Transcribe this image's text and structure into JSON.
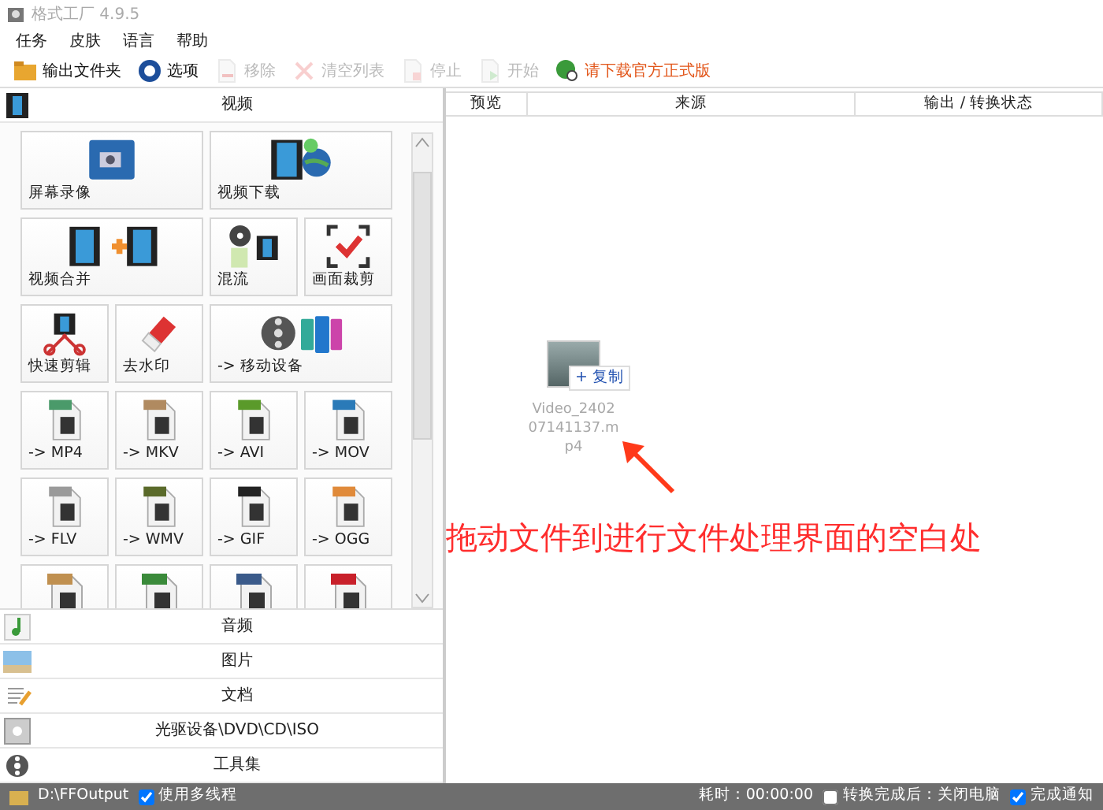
{
  "window": {
    "title": "格式工厂 4.9.5",
    "active": false
  },
  "menu": [
    "任务",
    "皮肤",
    "语言",
    "帮助"
  ],
  "toolbar": [
    {
      "kind": "folder",
      "label": "输出文件夹",
      "disabled": false
    },
    {
      "kind": "options",
      "label": "选项",
      "disabled": false
    },
    {
      "kind": "remove",
      "label": "移除",
      "disabled": true
    },
    {
      "kind": "clear",
      "label": "清空列表",
      "disabled": true
    },
    {
      "kind": "stop",
      "label": "停止",
      "disabled": true
    },
    {
      "kind": "start",
      "label": "开始",
      "disabled": true
    },
    {
      "kind": "link",
      "label": "请下载官方正式版",
      "disabled": false
    }
  ],
  "sidebar": {
    "open_category": {
      "kind": "video",
      "label": "视频"
    },
    "categories": [
      {
        "kind": "audio",
        "label": "音频"
      },
      {
        "kind": "image",
        "label": "图片"
      },
      {
        "kind": "document",
        "label": "文档"
      },
      {
        "kind": "disc",
        "label": "光驱设备\\DVD\\CD\\ISO"
      },
      {
        "kind": "tools",
        "label": "工具集"
      }
    ],
    "tiles": [
      {
        "kind": "screen",
        "label": "屏幕录像",
        "wide": true
      },
      {
        "kind": "download",
        "label": "视频下载",
        "wide": true
      },
      {
        "kind": "merge",
        "label": "视频合并",
        "wide": true
      },
      {
        "kind": "mux",
        "label": "混流",
        "wide": false
      },
      {
        "kind": "crop",
        "label": "画面裁剪",
        "wide": false
      },
      {
        "kind": "cut",
        "label": "快速剪辑",
        "wide": false
      },
      {
        "kind": "watermark",
        "label": "去水印",
        "wide": false
      },
      {
        "kind": "device",
        "label": "-> 移动设备",
        "wide": true
      },
      {
        "kind": "format",
        "label": "-> MP4",
        "wide": false,
        "color": "#4a9a6a"
      },
      {
        "kind": "format",
        "label": "-> MKV",
        "wide": false,
        "color": "#b08a60"
      },
      {
        "kind": "format",
        "label": "-> AVI",
        "wide": false,
        "color": "#5a9a2a"
      },
      {
        "kind": "format",
        "label": "-> MOV",
        "wide": false,
        "color": "#2a7ab8"
      },
      {
        "kind": "format",
        "label": "-> FLV",
        "wide": false,
        "color": "#9a9a9a"
      },
      {
        "kind": "format",
        "label": "-> WMV",
        "wide": false,
        "color": "#5a6a2a"
      },
      {
        "kind": "format",
        "label": "-> GIF",
        "wide": false,
        "color": "#222222"
      },
      {
        "kind": "format",
        "label": "-> OGG",
        "wide": false,
        "color": "#e08a3a"
      },
      {
        "kind": "format",
        "wide": false,
        "color": "#c09050"
      },
      {
        "kind": "format",
        "wide": false,
        "color": "#3a8a3a"
      },
      {
        "kind": "format",
        "wide": false,
        "color": "#3a5a8a"
      },
      {
        "kind": "format",
        "wide": false,
        "color": "#c8202a"
      }
    ]
  },
  "file_list": {
    "columns": [
      "预览",
      "来源",
      "输出 / 转换状态"
    ],
    "dragged_file": {
      "name_lines": [
        "Video_2402",
        "07141137.m",
        "p4"
      ],
      "tooltip": "+ 复制"
    },
    "annotation": "拖动文件到进行文件处理界面的空白处"
  },
  "status_bar": {
    "output_path": "D:\\FFOutput",
    "options": [
      {
        "label": "使用多线程",
        "checked": true
      }
    ],
    "elapsed": "耗时：00:00:00",
    "right_options": [
      {
        "label": "转换完成后：关闭电脑",
        "checked": false
      },
      {
        "label": "完成通知",
        "checked": true
      }
    ]
  }
}
